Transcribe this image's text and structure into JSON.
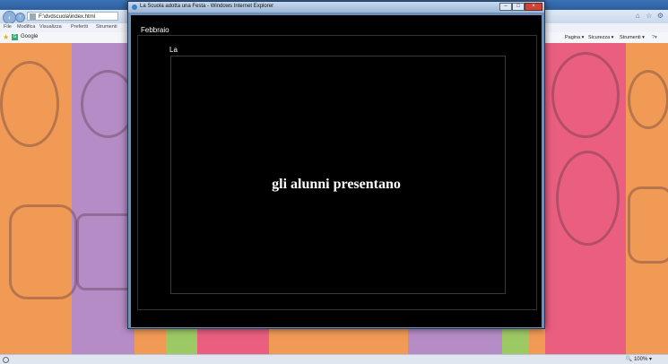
{
  "browser": {
    "address_url": "F:\\dvdscuola\\index.html",
    "menu": [
      "File",
      "Modifica",
      "Visualizza",
      "Preferiti",
      "Strumenti"
    ],
    "favorites_item": "Google",
    "command_bar": [
      "Pagina",
      "Sicurezza",
      "Strumenti"
    ],
    "zoom": "100%"
  },
  "popup": {
    "title": "La Scuola adotta una Festa - Windows Internet Explorer",
    "controls": {
      "minimize": "–",
      "maximize": "□",
      "close": "×"
    }
  },
  "slide": {
    "month": "Febbraio",
    "top_text": "La",
    "headline": "gli alunni presentano"
  },
  "colors": {
    "stripe_orange": "#f09a55",
    "stripe_purple": "#b68cc6",
    "stripe_pink": "#ea5f80",
    "stripe_green": "#9dc964",
    "stripe_red": "#e84c5a"
  }
}
